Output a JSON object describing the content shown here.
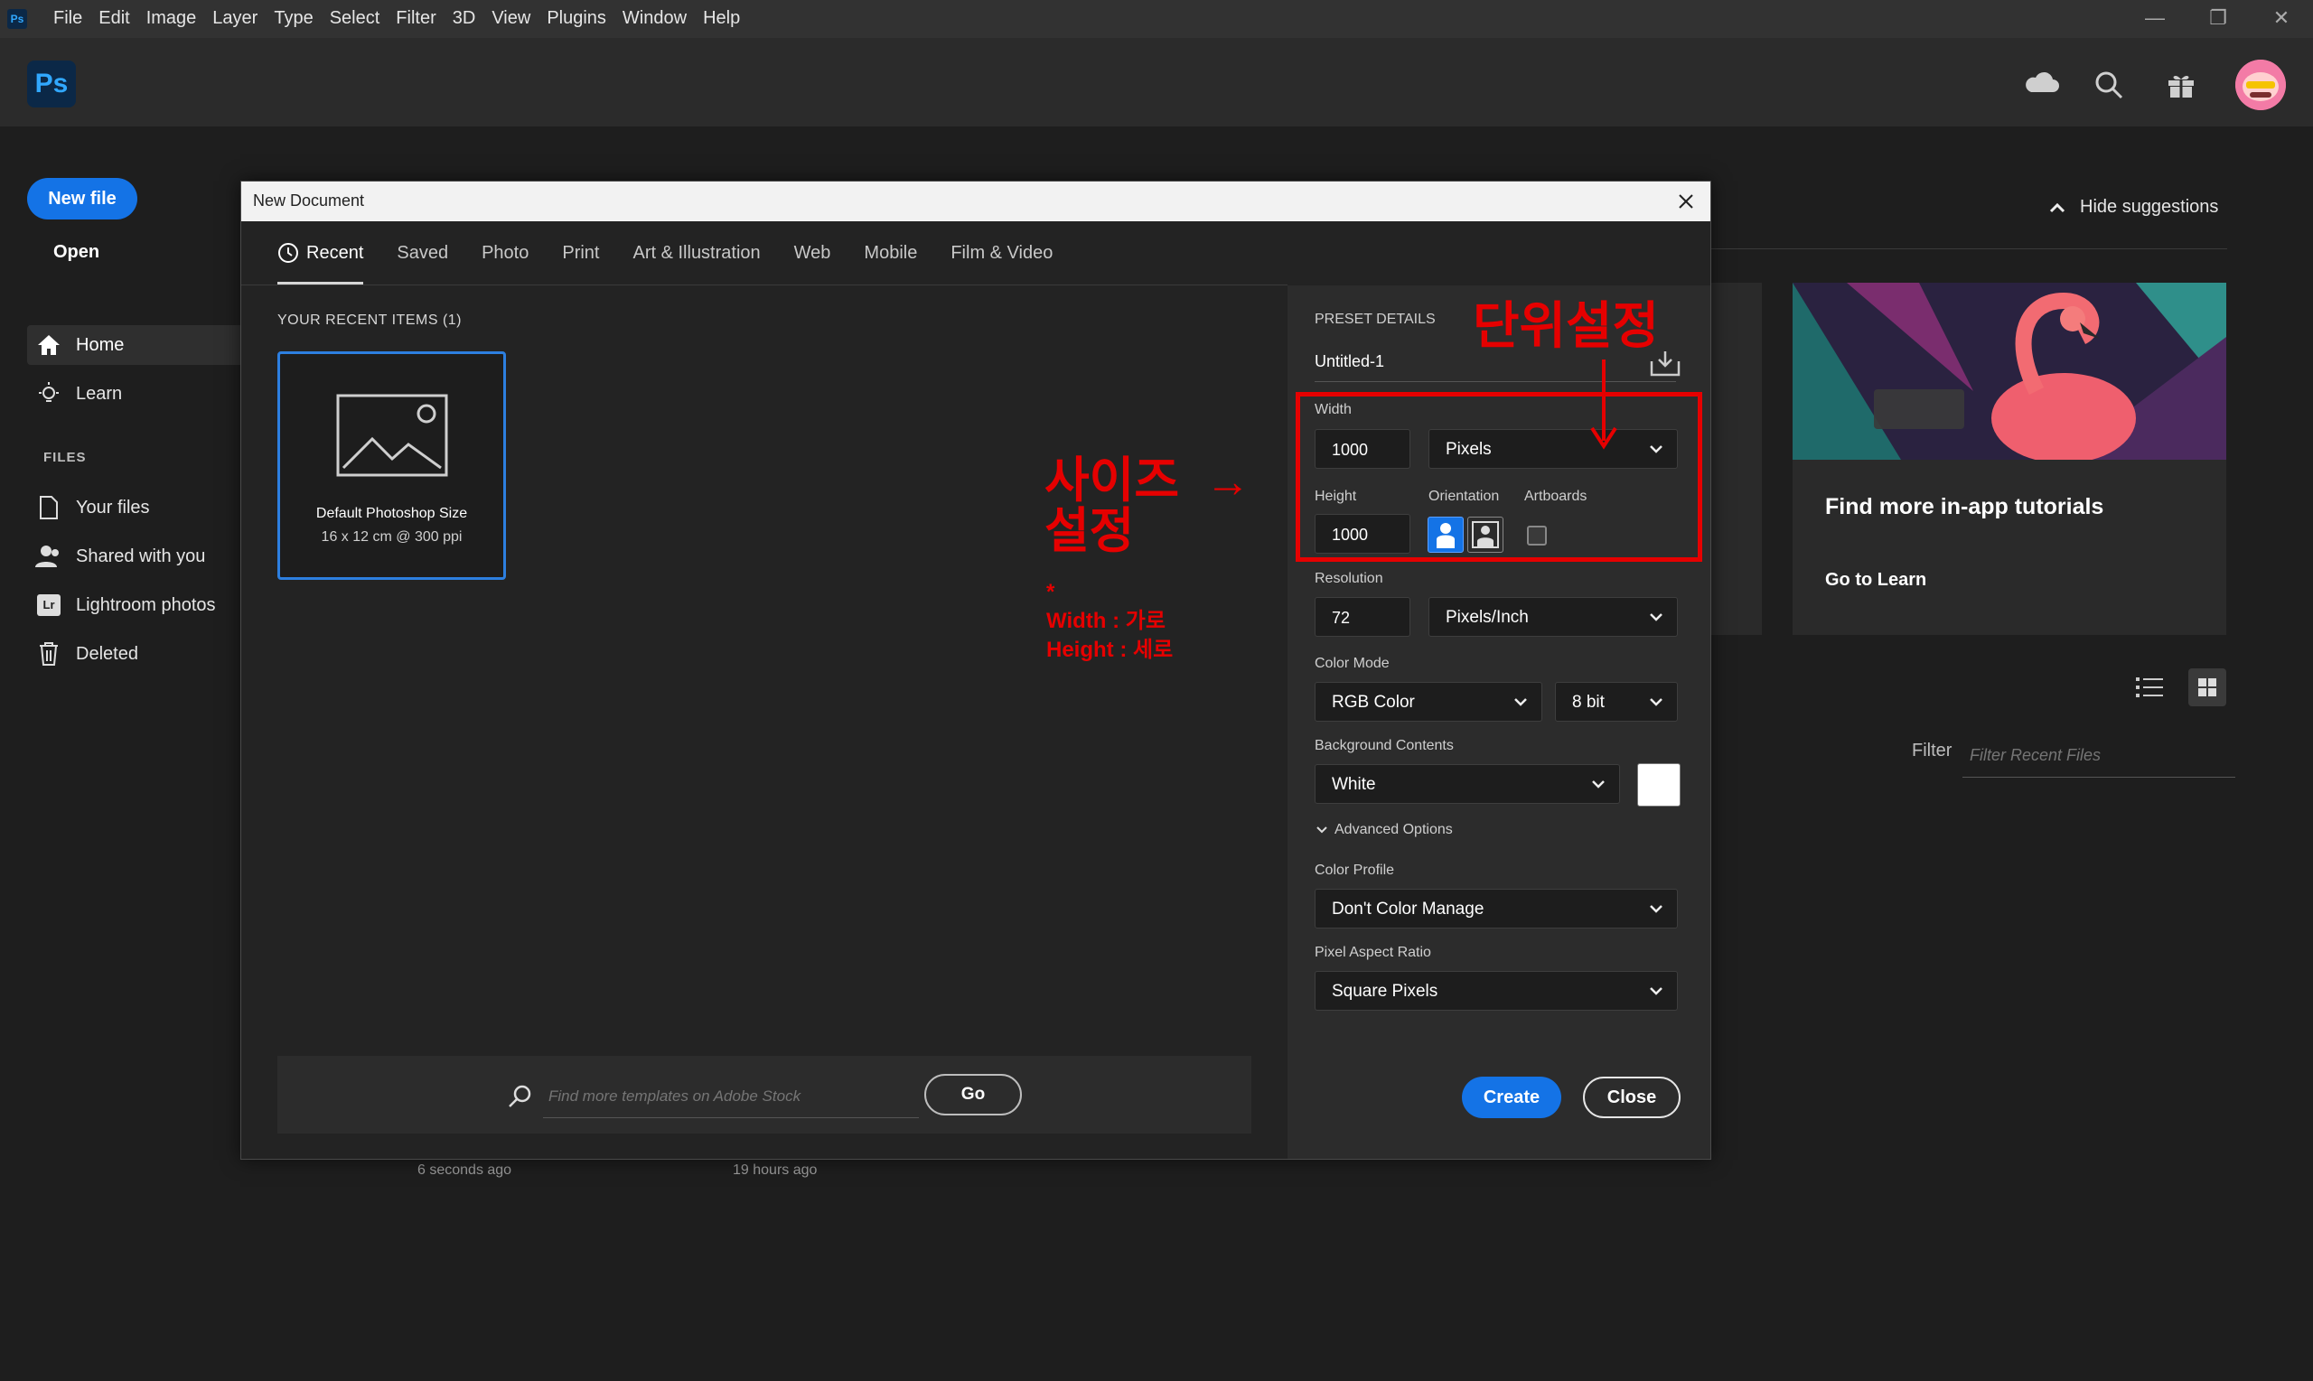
{
  "menubar": {
    "items": [
      "File",
      "Edit",
      "Image",
      "Layer",
      "Type",
      "Select",
      "Filter",
      "3D",
      "View",
      "Plugins",
      "Window",
      "Help"
    ],
    "app_badge": "Ps"
  },
  "header": {
    "logo": "Ps"
  },
  "home": {
    "new_file": "New file",
    "open": "Open",
    "nav": {
      "home": "Home",
      "learn": "Learn"
    },
    "files_label": "FILES",
    "files_nav": [
      "Your files",
      "Shared with you",
      "Lightroom photos",
      "Deleted"
    ],
    "lr_badge": "Lr",
    "hide_suggestions": "Hide suggestions",
    "tutorial_title": "Find more in-app tutorials",
    "tutorial_link": "Go to Learn",
    "filter_label": "Filter",
    "filter_placeholder": "Filter Recent Files",
    "times": [
      "6 seconds ago",
      "19 hours ago"
    ]
  },
  "dialog": {
    "title": "New Document",
    "tabs": [
      "Recent",
      "Saved",
      "Photo",
      "Print",
      "Art & Illustration",
      "Web",
      "Mobile",
      "Film & Video"
    ],
    "recent_label": "YOUR RECENT ITEMS  (1)",
    "recent_item": {
      "name": "Default Photoshop Size",
      "size": "16 x 12 cm @ 300 ppi"
    },
    "stock_placeholder": "Find more templates on Adobe Stock",
    "go": "Go",
    "preset": {
      "header": "PRESET DETAILS",
      "doc_name": "Untitled-1",
      "width_label": "Width",
      "width_value": "1000",
      "unit": "Pixels",
      "height_label": "Height",
      "height_value": "1000",
      "orientation_label": "Orientation",
      "artboards_label": "Artboards",
      "resolution_label": "Resolution",
      "resolution_value": "72",
      "resolution_unit": "Pixels/Inch",
      "color_mode_label": "Color Mode",
      "color_mode": "RGB Color",
      "bit_depth": "8 bit",
      "background_label": "Background Contents",
      "background": "White",
      "advanced": "Advanced Options",
      "color_profile_label": "Color Profile",
      "color_profile": "Don't Color Manage",
      "pixel_aspect_label": "Pixel Aspect Ratio",
      "pixel_aspect": "Square Pixels"
    },
    "create": "Create",
    "close": "Close"
  },
  "annotations": {
    "unit_setting": "단위설정",
    "size_setting_line1": "사이즈",
    "size_setting_line2": "설정",
    "arrow": "→",
    "note_star": "*",
    "note_width": "Width : 가로",
    "note_height": "Height : 세로"
  },
  "colors": {
    "accent": "#1473e6",
    "annotation": "#e60000",
    "dialog_bg": "#232323",
    "panel_bg": "#2c2c2c"
  }
}
